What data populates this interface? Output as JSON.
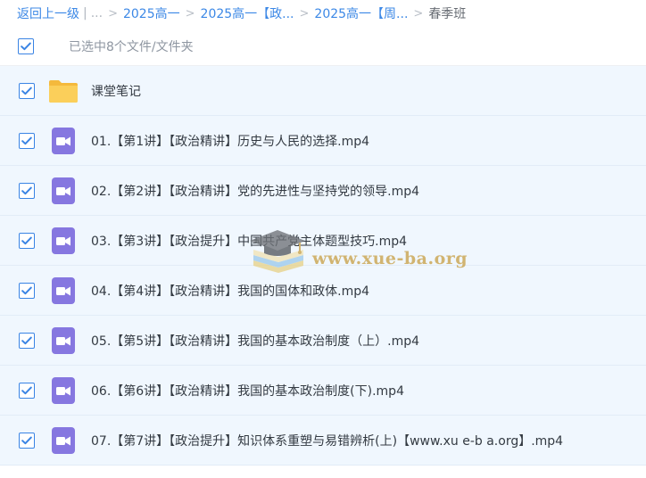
{
  "breadcrumb": {
    "back": "返回上一级",
    "divider": "|",
    "ellipsis": "...",
    "items": [
      "2025高一",
      "2025高一【政...",
      "2025高一【周..."
    ],
    "separator": ">",
    "current": "春季班"
  },
  "selection": {
    "checked": true,
    "label": "已选中8个文件/文件夹"
  },
  "files": [
    {
      "name": "课堂笔记",
      "type": "folder",
      "checked": true
    },
    {
      "name": "01.【第1讲】【政治精讲】历史与人民的选择.mp4",
      "type": "video",
      "checked": true
    },
    {
      "name": "02.【第2讲】【政治精讲】党的先进性与坚持党的领导.mp4",
      "type": "video",
      "checked": true
    },
    {
      "name": "03.【第3讲】【政治提升】中国共产党主体题型技巧.mp4",
      "type": "video",
      "checked": true
    },
    {
      "name": "04.【第4讲】【政治精讲】我国的国体和政体.mp4",
      "type": "video",
      "checked": true
    },
    {
      "name": "05.【第5讲】【政治精讲】我国的基本政治制度（上）.mp4",
      "type": "video",
      "checked": true
    },
    {
      "name": "06.【第6讲】【政治精讲】我国的基本政治制度(下).mp4",
      "type": "video",
      "checked": true
    },
    {
      "name": "07.【第7讲】【政治提升】知识体系重塑与易错辨析(上)【www.xu e-b a.org】.mp4",
      "type": "video",
      "checked": true
    }
  ],
  "watermark": {
    "text": "www.xue-ba.org"
  },
  "colors": {
    "accent": "#3a84e4",
    "folder": "#f8c94f",
    "video": "#8677e0",
    "row_bg": "#f0f7fe"
  },
  "icons": {
    "folder": "folder-icon",
    "video": "video-file-icon",
    "check": "checkmark-icon"
  }
}
